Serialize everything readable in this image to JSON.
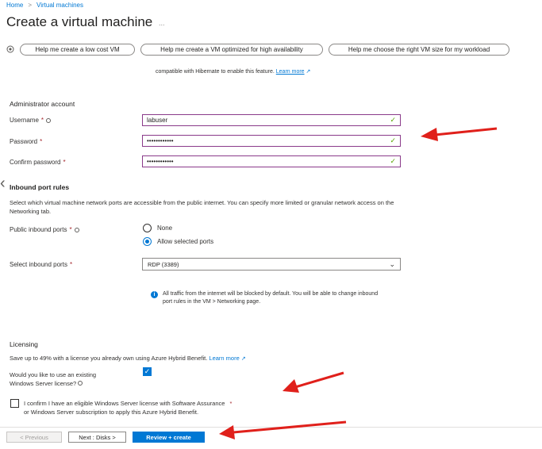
{
  "breadcrumb": {
    "home": "Home",
    "sep": ">",
    "current": "Virtual machines"
  },
  "page": {
    "title": "Create a virtual machine",
    "title_more": "..."
  },
  "copilot": {
    "buttons": [
      "Help me create a low cost VM",
      "Help me create a VM optimized for high availability",
      "Help me choose the right VM size for my workload"
    ]
  },
  "hibernate": {
    "text": "compatible with Hibernate to enable this feature.",
    "link": "Learn more"
  },
  "admin": {
    "section": "Administrator account",
    "username_label": "Username",
    "username_value": "labuser",
    "password_label": "Password",
    "password_value": "••••••••••••",
    "confirm_label": "Confirm password",
    "confirm_value": "••••••••••••",
    "required": "*"
  },
  "inbound": {
    "section": "Inbound port rules",
    "description": "Select which virtual machine network ports are accessible from the public internet. You can specify more limited or granular network access on the Networking tab.",
    "public_label": "Public inbound ports",
    "option_none": "None",
    "option_allow": "Allow selected ports",
    "select_label": "Select inbound ports",
    "select_value": "RDP (3389)",
    "note": "All traffic from the internet will be blocked by default. You will be able to change inbound port rules in the VM > Networking page."
  },
  "licensing": {
    "section": "Licensing",
    "text": "Save up to 49% with a license you already own using Azure Hybrid Benefit.",
    "link": "Learn more",
    "existing_label_1": "Would you like to use an existing",
    "existing_label_2": "Windows Server license?",
    "confirm_line_1": "I confirm I have an eligible Windows Server license with Software Assurance",
    "confirm_line_2": "or Windows Server subscription to apply this Azure Hybrid Benefit."
  },
  "footer": {
    "previous": "< Previous",
    "next": "Next : Disks >",
    "review": "Review + create"
  },
  "colors": {
    "accent": "#0078d4",
    "arrow": "#e0201b",
    "valid": "#57a300"
  }
}
